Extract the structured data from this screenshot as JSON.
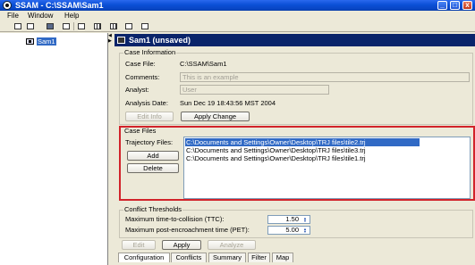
{
  "window": {
    "title": "SSAM - C:\\SSAM\\Sam1",
    "minimize": "_",
    "maximize": "□",
    "close": "x"
  },
  "menu": [
    "File",
    "Window",
    "Help"
  ],
  "tree": {
    "node_label": "Sam1"
  },
  "frame": {
    "title": "Sam1 (unsaved)"
  },
  "case_info": {
    "section_title": "Case Information",
    "case_file_label": "Case File:",
    "case_file_value": "C:\\SSAM\\Sam1",
    "comments_label": "Comments:",
    "comments_value": "This is an example",
    "analyst_label": "Analyst:",
    "analyst_value": "User",
    "analysis_date_label": "Analysis Date:",
    "analysis_date_value": "Sun Dec 19 18:43:56 MST 2004",
    "edit_info_label": "Edit Info",
    "apply_change_label": "Apply Change"
  },
  "case_files": {
    "section_title": "Case Files",
    "trajectory_label": "Trajectory Files:",
    "add_label": "Add",
    "delete_label": "Delete",
    "files": [
      "C:\\Documents and Settings\\Owner\\Desktop\\TRJ files\\tile2.trj",
      "C:\\Documents and Settings\\Owner\\Desktop\\TRJ files\\tile3.trj",
      "C:\\Documents and Settings\\Owner\\Desktop\\TRJ files\\tile1.trj"
    ],
    "highlight_color": "#d2232a"
  },
  "conflict": {
    "section_title": "Conflict Thresholds",
    "ttc_label": "Maximum time-to-collision (TTC):",
    "ttc_value": "1.50",
    "pet_label": "Maximum post-encroachment time (PET):",
    "pet_value": "5.00"
  },
  "actions": {
    "edit_label": "Edit",
    "apply_label": "Apply",
    "analyze_label": "Analyze"
  },
  "tabs": [
    "Configuration",
    "Conflicts",
    "Summary",
    "Filter",
    "Map"
  ]
}
